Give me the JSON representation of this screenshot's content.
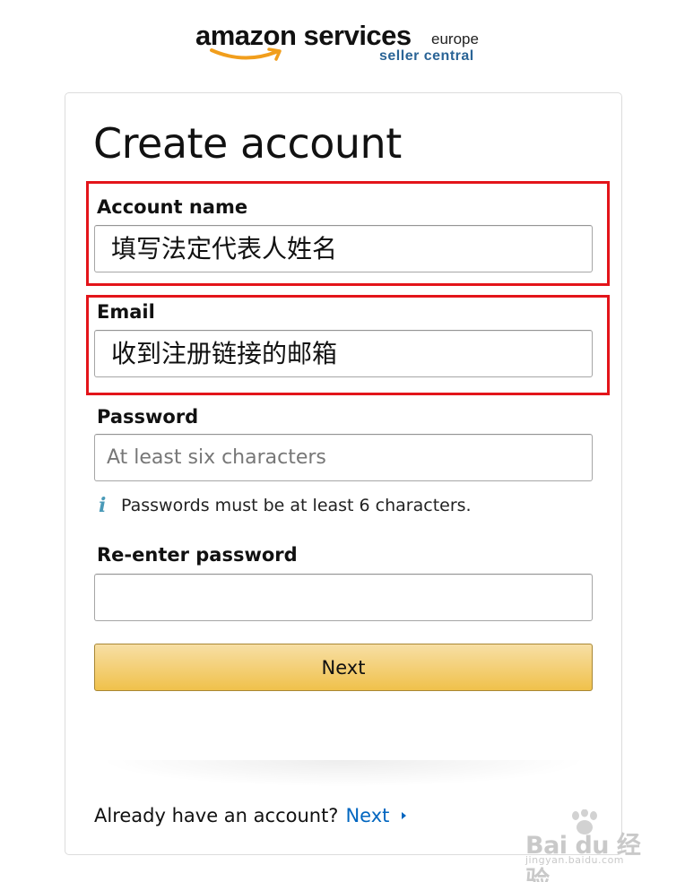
{
  "header": {
    "logo_main": "amazon services",
    "logo_region": "europe",
    "logo_sub": "seller central"
  },
  "form": {
    "title": "Create account",
    "account_name": {
      "label": "Account name",
      "value": "填写法定代表人姓名"
    },
    "email": {
      "label": "Email",
      "value": "收到注册链接的邮箱"
    },
    "password": {
      "label": "Password",
      "placeholder": "At least six characters"
    },
    "password_hint": "Passwords must be at least 6 characters.",
    "reenter_password": {
      "label": "Re-enter password",
      "value": ""
    },
    "next_button": "Next"
  },
  "footer": {
    "signin_prompt": "Already have an account?",
    "signin_link": "Next"
  },
  "watermark": {
    "text": "Bai du 经验",
    "url": "jingyan.baidu.com"
  },
  "colors": {
    "highlight": "#e3141a",
    "button": "#f0c14b",
    "link": "#0066c0",
    "info_icon": "#4a9ab8",
    "logo_sub": "#2a6496"
  },
  "icons": {
    "info": "info-icon",
    "caret": "caret-right-icon",
    "smile": "amazon-smile-icon"
  }
}
